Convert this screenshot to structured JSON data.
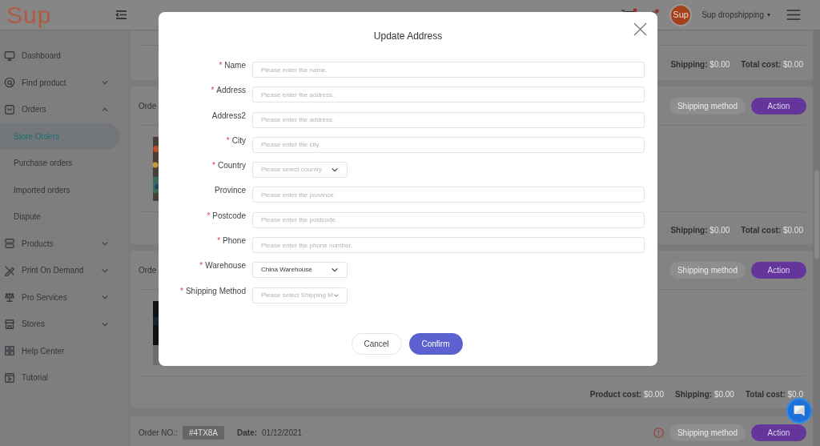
{
  "header": {
    "logo": "Sup",
    "avatar_text": "Sup",
    "account": "Sup dropshipping",
    "account_caret": "▾",
    "cart_alert": true,
    "bell_alert": true
  },
  "sidebar": {
    "items": [
      {
        "label": "Dashboard",
        "has_submenu": false
      },
      {
        "label": "Find product",
        "has_submenu": true,
        "expanded": false
      },
      {
        "label": "Orders",
        "has_submenu": true,
        "expanded": true,
        "children": [
          {
            "label": "Store Orders",
            "selected": true
          },
          {
            "label": "Purchase orders",
            "selected": false
          },
          {
            "label": "Imported orders",
            "selected": false
          },
          {
            "label": "Dispute",
            "selected": false
          }
        ]
      },
      {
        "label": "Products",
        "has_submenu": true,
        "expanded": false
      },
      {
        "label": "Print On Demand",
        "has_submenu": true,
        "expanded": false
      },
      {
        "label": "Pro Services",
        "has_submenu": true,
        "expanded": false
      },
      {
        "label": "Stores",
        "has_submenu": true,
        "expanded": false
      },
      {
        "label": "Help Center",
        "has_submenu": false
      },
      {
        "label": "Tutorial",
        "has_submenu": false
      }
    ]
  },
  "orders": [
    {
      "kind": "tail",
      "footer": [
        {
          "label": "Shipping:",
          "value": "$0.00"
        },
        {
          "label": "Total cost:",
          "value": "$0.00"
        }
      ]
    },
    {
      "kind": "full",
      "order_label": "Orde",
      "buttons": [
        "Shipping method",
        "Action"
      ],
      "footer": [
        {
          "label": "Shipping:",
          "value": "$0.00"
        },
        {
          "label": "Total cost:",
          "value": "$0.00"
        }
      ]
    },
    {
      "kind": "full",
      "order_label": "Orde",
      "buttons": [
        "Shipping method",
        "Action"
      ],
      "footer": [
        {
          "label": "Product cost:",
          "value": "$0.00"
        },
        {
          "label": "Shipping:",
          "value": "$0.00"
        },
        {
          "label": "Total cost:",
          "value": "$0.0"
        }
      ]
    },
    {
      "kind": "head",
      "order_label": "Order NO.:",
      "order_no": "#4TX8A",
      "date_label": "Date:",
      "date": "01/12/2021",
      "alert": true,
      "buttons": [
        "Shipping method",
        "Action"
      ]
    }
  ],
  "dialog": {
    "title": "Update Address",
    "required_mark": "*",
    "fields": [
      {
        "label": "Name",
        "required": true,
        "kind": "text",
        "placeholder": "Please enter the name."
      },
      {
        "label": "Address",
        "required": true,
        "kind": "text",
        "placeholder": "Please enter the address."
      },
      {
        "label": "Address2",
        "required": false,
        "kind": "text",
        "placeholder": "Please enter the address."
      },
      {
        "label": "City",
        "required": true,
        "kind": "text",
        "placeholder": "Please enter the city."
      },
      {
        "label": "Country",
        "required": true,
        "kind": "select",
        "placeholder": "Please select country"
      },
      {
        "label": "Province",
        "required": false,
        "kind": "text",
        "placeholder": "Please enter the province."
      },
      {
        "label": "Postcode",
        "required": true,
        "kind": "text",
        "placeholder": "Please enter the postcode."
      },
      {
        "label": "Phone",
        "required": true,
        "kind": "text",
        "placeholder": "Please enter the phone number."
      },
      {
        "label": "Warehouse",
        "required": true,
        "kind": "select",
        "value": "China Warehouse"
      },
      {
        "label": "Shipping Method",
        "required": true,
        "kind": "select",
        "placeholder": "Please select Shipping M"
      }
    ],
    "cancel": "Cancel",
    "confirm": "Confirm"
  }
}
